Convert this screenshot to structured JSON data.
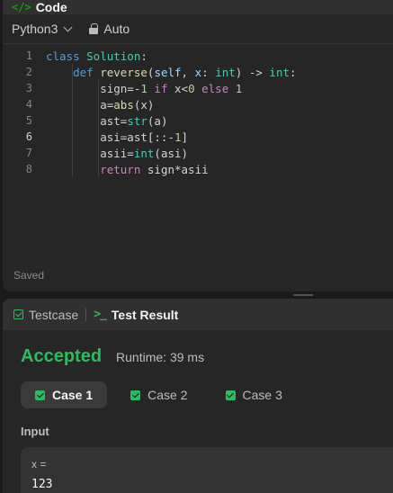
{
  "code_panel": {
    "title": "Code",
    "language": "Python3",
    "mode": "Auto",
    "status": "Saved",
    "active_line": 6,
    "line_numbers": [
      "1",
      "2",
      "3",
      "4",
      "5",
      "6",
      "7",
      "8"
    ]
  },
  "code_lines": [
    [
      {
        "t": "class ",
        "c": "kw"
      },
      {
        "t": "Solution",
        "c": "cls"
      },
      {
        "t": ":",
        "c": ""
      }
    ],
    [
      {
        "t": "    def ",
        "c": "kw"
      },
      {
        "t": "reverse",
        "c": "fn"
      },
      {
        "t": "(",
        "c": ""
      },
      {
        "t": "self",
        "c": "par"
      },
      {
        "t": ", ",
        "c": ""
      },
      {
        "t": "x",
        "c": "par"
      },
      {
        "t": ": ",
        "c": ""
      },
      {
        "t": "int",
        "c": "cls"
      },
      {
        "t": ") -> ",
        "c": ""
      },
      {
        "t": "int",
        "c": "cls"
      },
      {
        "t": ":",
        "c": ""
      }
    ],
    [
      {
        "t": "        sign=-",
        "c": ""
      },
      {
        "t": "1",
        "c": "num"
      },
      {
        "t": " if ",
        "c": "ctrl"
      },
      {
        "t": "x<",
        "c": ""
      },
      {
        "t": "0",
        "c": "num"
      },
      {
        "t": " else ",
        "c": "ctrl"
      },
      {
        "t": "1",
        "c": "num"
      }
    ],
    [
      {
        "t": "        a=",
        "c": ""
      },
      {
        "t": "abs",
        "c": "fn"
      },
      {
        "t": "(x)",
        "c": ""
      }
    ],
    [
      {
        "t": "        ast=",
        "c": ""
      },
      {
        "t": "str",
        "c": "cls"
      },
      {
        "t": "(a)",
        "c": ""
      }
    ],
    [
      {
        "t": "        asi=ast[::-",
        "c": ""
      },
      {
        "t": "1",
        "c": "num"
      },
      {
        "t": "]",
        "c": ""
      }
    ],
    [
      {
        "t": "        asii=",
        "c": ""
      },
      {
        "t": "int",
        "c": "cls"
      },
      {
        "t": "(asi)",
        "c": ""
      }
    ],
    [
      {
        "t": "        return ",
        "c": "ctrl"
      },
      {
        "t": "sign*asii",
        "c": ""
      }
    ]
  ],
  "result_panel": {
    "tab_testcase": "Testcase",
    "tab_result": "Test Result",
    "verdict": "Accepted",
    "runtime": "Runtime: 39 ms",
    "cases": [
      "Case 1",
      "Case 2",
      "Case 3"
    ],
    "input_label": "Input",
    "input_name": "x =",
    "input_value": "123"
  },
  "colors": {
    "accent_green": "#2cbb5d",
    "background": "#1a1a1a",
    "panel": "#262626"
  }
}
